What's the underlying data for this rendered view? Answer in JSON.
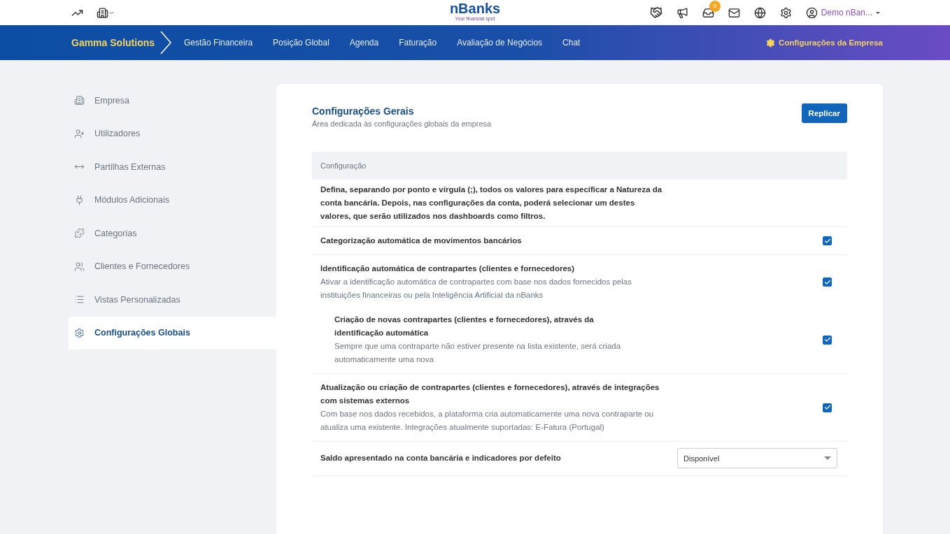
{
  "topbar": {
    "logo": "nBanks",
    "tagline": "Your financial spot",
    "notification_count": "5",
    "user": "Demo nBan..."
  },
  "nav": {
    "company": "Gamma Solutions",
    "items": [
      "Gestão Financeira",
      "Posição Global",
      "Agenda",
      "Faturação",
      "Avaliação de Negócios",
      "Chat"
    ],
    "settings_link": "Configurações da Empresa"
  },
  "sidebar": {
    "items": [
      {
        "label": "Empresa",
        "selected": false
      },
      {
        "label": "Utilizadores",
        "selected": false
      },
      {
        "label": "Partilhas Externas",
        "selected": false
      },
      {
        "label": "Módulos Adicionais",
        "selected": false
      },
      {
        "label": "Categorias",
        "selected": false
      },
      {
        "label": "Clientes e Fornecedores",
        "selected": false
      },
      {
        "label": "Vistas Personalizadas",
        "selected": false
      },
      {
        "label": "Configurações Globais",
        "selected": true
      }
    ]
  },
  "panel": {
    "title": "Configurações Gerais",
    "subtitle": "Área dedicada às configurações globais da empresa",
    "button": "Replicar",
    "table_header": "Configuração",
    "rows": [
      {
        "kind": "text",
        "title": "Defina, separando por ponto e vírgula (;), todos os valores para especificar a Natureza da conta bancária. Depois, nas configurações da conta, poderá selecionar um destes valores, que serão utilizados nos dashboards como filtros."
      },
      {
        "kind": "checkbox",
        "title": "Categorização automática de movimentos bancários",
        "checked": true
      },
      {
        "kind": "checkbox",
        "title": "Identificação automática de contrapartes (clientes e fornecedores)",
        "description": "Ativar a identificação automática de contrapartes com base nos dados fornecidos pelas instituições financeiras ou pela Inteligência Artificial da nBanks",
        "checked": true,
        "children": [
          {
            "kind": "checkbox",
            "title": "Criação de novas contrapartes (clientes e fornecedores), através da identificação automática",
            "description": "Sempre que uma contraparte não estiver presente na lista existente, será criada automaticamente uma nova",
            "checked": true
          }
        ]
      },
      {
        "kind": "checkbox",
        "title": "Atualização ou criação de contrapartes (clientes e fornecedores), através de integrações com sistemas externos",
        "description": "Com base nos dados recebidos, a plataforma cria automaticamente uma nova contraparte ou atualiza uma existente. Integrações atualmente suportadas: E-Fatura (Portugal)",
        "checked": true
      },
      {
        "kind": "select",
        "title": "Saldo apresentado na conta bancária e indicadores por defeito",
        "value": "Disponível"
      }
    ]
  }
}
